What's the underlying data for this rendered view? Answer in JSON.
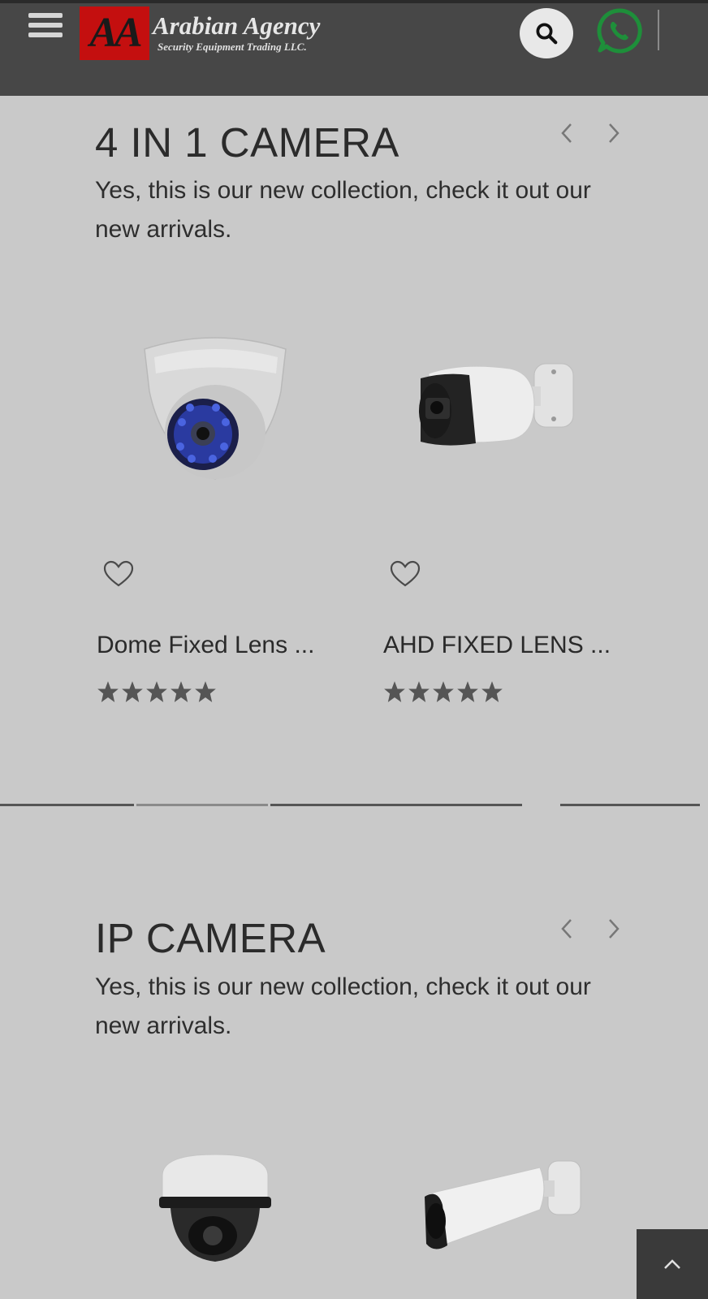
{
  "header": {
    "logo_mark": "AA",
    "logo_name": "Arabian Agency",
    "logo_subtitle": "Security Equipment Trading LLC.",
    "menu_icon": "hamburger-icon",
    "search_icon": "search-icon",
    "whatsapp_icon": "whatsapp-icon"
  },
  "sections": [
    {
      "title": "4 IN 1 CAMERA",
      "description": "Yes, this is our new collection, check it out our new arrivals.",
      "products": [
        {
          "name": "Dome Fixed Lens ...",
          "rating": 5
        },
        {
          "name": "AHD FIXED LENS ...",
          "rating": 5
        }
      ]
    },
    {
      "title": "IP CAMERA",
      "description": "Yes, this is our new collection, check it out our new arrivals.",
      "products": [
        {
          "name": "",
          "rating": null
        },
        {
          "name": "",
          "rating": null
        }
      ]
    }
  ],
  "colors": {
    "header_bg": "#474747",
    "page_bg": "#c9c9c9",
    "logo_red": "#c40f0f",
    "whatsapp_green": "#1e8f3a"
  }
}
